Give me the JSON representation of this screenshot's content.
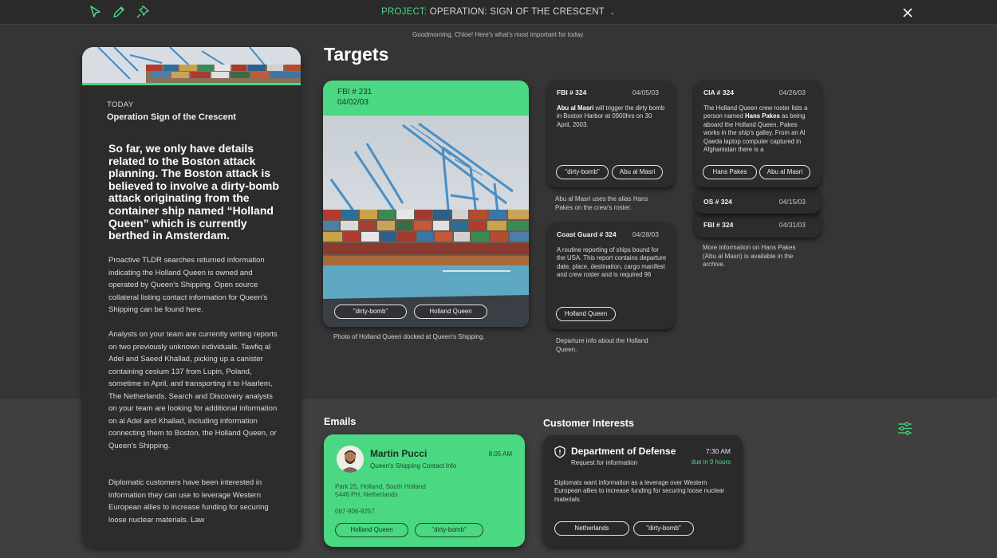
{
  "toolbar": {
    "icons": [
      "pointer-icon",
      "pencil-icon",
      "pin-icon",
      "close-icon"
    ],
    "project_prefix": "PROJECT:",
    "project_name": "OPERATION: SIGN OF THE CRESCENT",
    "greeting": "Goodmorning, Chloe! Here's what's most important for today."
  },
  "summary": {
    "today_label": "TODAY",
    "operation": "Operation Sign of the Crescent",
    "headline": "So far, we only have details related to the Boston attack planning. The Boston attack is believed to involve a dirty-bomb attack originating from the container ship named “Holland Queen” which is currently berthed in Amsterdam.",
    "para1": "Proactive TLDR searches returned information indicating the Holland Queen is owned and operated by Queen's Shipping. Open source collateral listing contact information for Queen's Shipping can be found here.",
    "para2": "Analysts on your team are currently writing reports on two previously unknown individuals. Tawfiq al Adel and Saeed Khallad, picking up a canister containing cesium 137 from Lupin, Poland, sometime in April, and transporting it to Haarlem, The Netherlands. Search and Discovery analysts on your team are looking for additional information on al Adel and Khallad, including information connecting them to Boston, the Holland Queen, or Queen's Shipping.",
    "para3": "Diplomatic customers have been interested in information they can use to leverage Western European allies to increase funding for securing loose nuclear materials. Law"
  },
  "targets": {
    "title": "Targets",
    "photo_card": {
      "id": "FBI # 231",
      "date": "04/02/03",
      "tags": [
        "\"dirty-bomb\"",
        "Holland Queen"
      ],
      "caption": "Photo of Holland Queen docked at Queen's Shipping."
    },
    "fbi324": {
      "id": "FBI # 324",
      "date": "04/05/03",
      "bold": "Abu al Masri",
      "body": " will trigger the dirty bomb in Boston Harbor at 0900hrs on 30 April, 2003.",
      "tags": [
        "\"dirty-bomb\"",
        "Abu al Masri"
      ],
      "caption": "Abu al Masri uses the alias Hans Pakes on the crew's roster."
    },
    "coast": {
      "id": "Coast Guard # 324",
      "date": "04/28/03",
      "body": "A routine reporting of ships bound for the USA. This report contains departure date, place, destination, cargo manifest and crew roster and is required 96",
      "tags": [
        "Holland Queen"
      ],
      "caption": "Departure info about the Holland Queen."
    },
    "cia324": {
      "id": "CIA # 324",
      "date": "04/26/03",
      "body_a": "The Holland Queen crew roster lists a person named ",
      "bold": "Hans Pakes",
      "body_b": " as being aboard the Holland Queen. Pakes works in the ship's galley. From an Al Qaeda laptop computer captured in Afghanistan there is a",
      "tags": [
        "Hans Pakes",
        "Abu al Masri"
      ]
    },
    "os324": {
      "id": "OS # 324",
      "date": "04/15/03"
    },
    "fbi324b": {
      "id": "FBI # 324",
      "date": "04/31/03",
      "caption": "More information on Hans Pakes (Abu al Masri) is available in the archive."
    }
  },
  "emails": {
    "title": "Emails",
    "name": "Martin Pucci",
    "subtitle": "Queen's Shipping Contact Info",
    "time": "8:05 AM",
    "address1": "Park 25, Holland, South Holland",
    "address2": "5446 PH, Netherlands",
    "phone": "067-906-9257",
    "tags": [
      "Holland Queen",
      "\"dirty-bomb\""
    ]
  },
  "customer": {
    "title": "Customer Interests",
    "org": "Department of Defense",
    "sub": "Request for information",
    "time": "7:30 AM",
    "due": "due in 9 hours",
    "body": "Diplomats want information  as a leverage over Western European allies to increase funding for securing loose nuclear materials.",
    "tags": [
      "Netherlands",
      "\"dirty-bomb\""
    ]
  },
  "colors": {
    "accent": "#4bd883",
    "background": "#353535",
    "card": "#2c2c2c"
  }
}
